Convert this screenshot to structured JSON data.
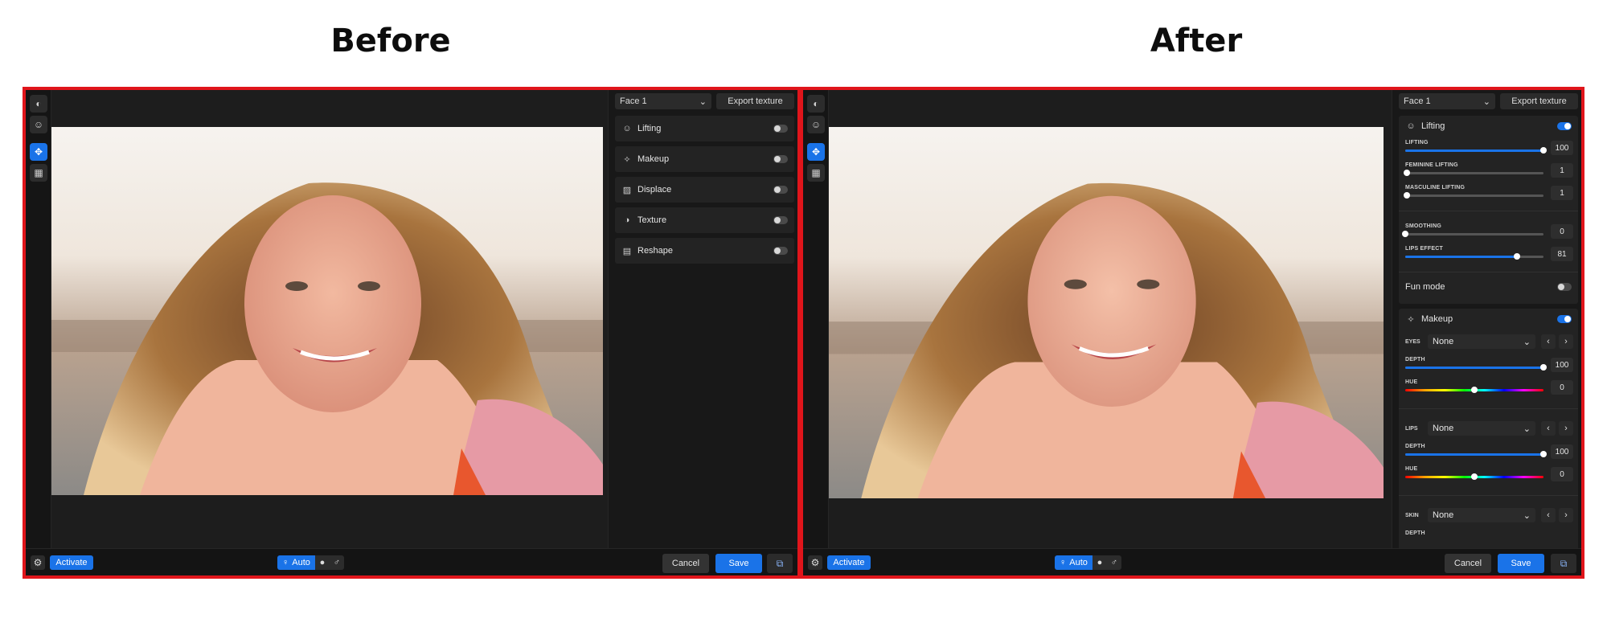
{
  "headings": {
    "before": "Before",
    "after": "After"
  },
  "colors": {
    "frame": "#e0151b",
    "accent": "#1a73e8",
    "panel_bg": "#181818"
  },
  "before": {
    "face_select": "Face 1",
    "export_button": "Export texture",
    "features": [
      {
        "icon": "lifting-icon",
        "label": "Lifting",
        "enabled": false
      },
      {
        "icon": "makeup-icon",
        "label": "Makeup",
        "enabled": false
      },
      {
        "icon": "displace-icon",
        "label": "Displace",
        "enabled": false
      },
      {
        "icon": "texture-icon",
        "label": "Texture",
        "enabled": false
      },
      {
        "icon": "reshape-icon",
        "label": "Reshape",
        "enabled": false
      }
    ],
    "bottom": {
      "activate": "Activate",
      "mode": "Auto",
      "cancel": "Cancel",
      "save": "Save"
    }
  },
  "after": {
    "face_select": "Face 1",
    "export_button": "Export texture",
    "lifting": {
      "label": "Lifting",
      "enabled": true,
      "sliders": [
        {
          "label": "LIFTING",
          "value": "100",
          "fraction": 1.0
        },
        {
          "label": "FEMININE LIFTING",
          "value": "1",
          "fraction": 0.01
        },
        {
          "label": "MASCULINE LIFTING",
          "value": "1",
          "fraction": 0.01
        },
        {
          "label": "SMOOTHING",
          "value": "0",
          "fraction": 0.0
        },
        {
          "label": "LIPS EFFECT",
          "value": "81",
          "fraction": 0.81
        }
      ],
      "fun_mode": {
        "label": "Fun mode",
        "enabled": false
      }
    },
    "makeup": {
      "label": "Makeup",
      "enabled": true,
      "groups": [
        {
          "label": "EYES",
          "selected": "None",
          "depth": {
            "label": "DEPTH",
            "value": "100",
            "fraction": 1.0
          },
          "hue": {
            "label": "HUE",
            "value": "0",
            "fraction": 0.5
          }
        },
        {
          "label": "LIPS",
          "selected": "None",
          "depth": {
            "label": "DEPTH",
            "value": "100",
            "fraction": 1.0
          },
          "hue": {
            "label": "HUE",
            "value": "0",
            "fraction": 0.5
          }
        },
        {
          "label": "SKIN",
          "selected": "None",
          "depth": {
            "label": "DEPTH"
          }
        }
      ]
    },
    "bottom": {
      "activate": "Activate",
      "mode": "Auto",
      "cancel": "Cancel",
      "save": "Save"
    }
  }
}
